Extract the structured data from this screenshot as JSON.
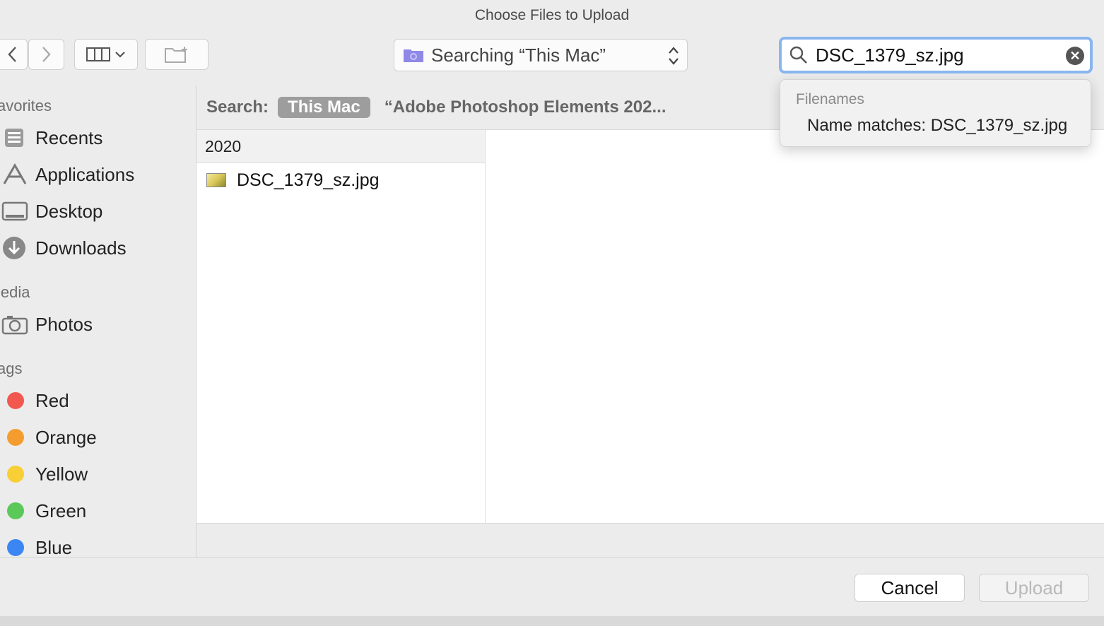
{
  "window": {
    "title": "Choose Files to Upload"
  },
  "toolbar": {
    "back_label": "<",
    "forward_label": ">",
    "location_text": "Searching “This Mac”",
    "search_value": "DSC_1379_sz.jpg"
  },
  "sidebar": {
    "sections": [
      {
        "header": "avorites",
        "items": [
          "Recents",
          "Applications",
          "Desktop",
          "Downloads"
        ]
      },
      {
        "header": "ledia",
        "items": [
          "Photos"
        ]
      },
      {
        "header": "ags",
        "items": [
          "Red",
          "Orange",
          "Yellow",
          "Green",
          "Blue"
        ]
      }
    ],
    "tag_colors": {
      "Red": "#f2584f",
      "Orange": "#f59c2f",
      "Yellow": "#f8cf34",
      "Green": "#5bc85a",
      "Blue": "#3b86f3"
    }
  },
  "scope": {
    "label": "Search:",
    "active": "This Mac",
    "other": "“Adobe Photoshop Elements 202..."
  },
  "results": {
    "group": "2020",
    "files": [
      {
        "name": "DSC_1379_sz.jpg",
        "icon": "image-thumbnail-icon"
      }
    ]
  },
  "suggestions": {
    "header": "Filenames",
    "item": "Name matches: DSC_1379_sz.jpg"
  },
  "footer": {
    "cancel": "Cancel",
    "upload": "Upload"
  }
}
